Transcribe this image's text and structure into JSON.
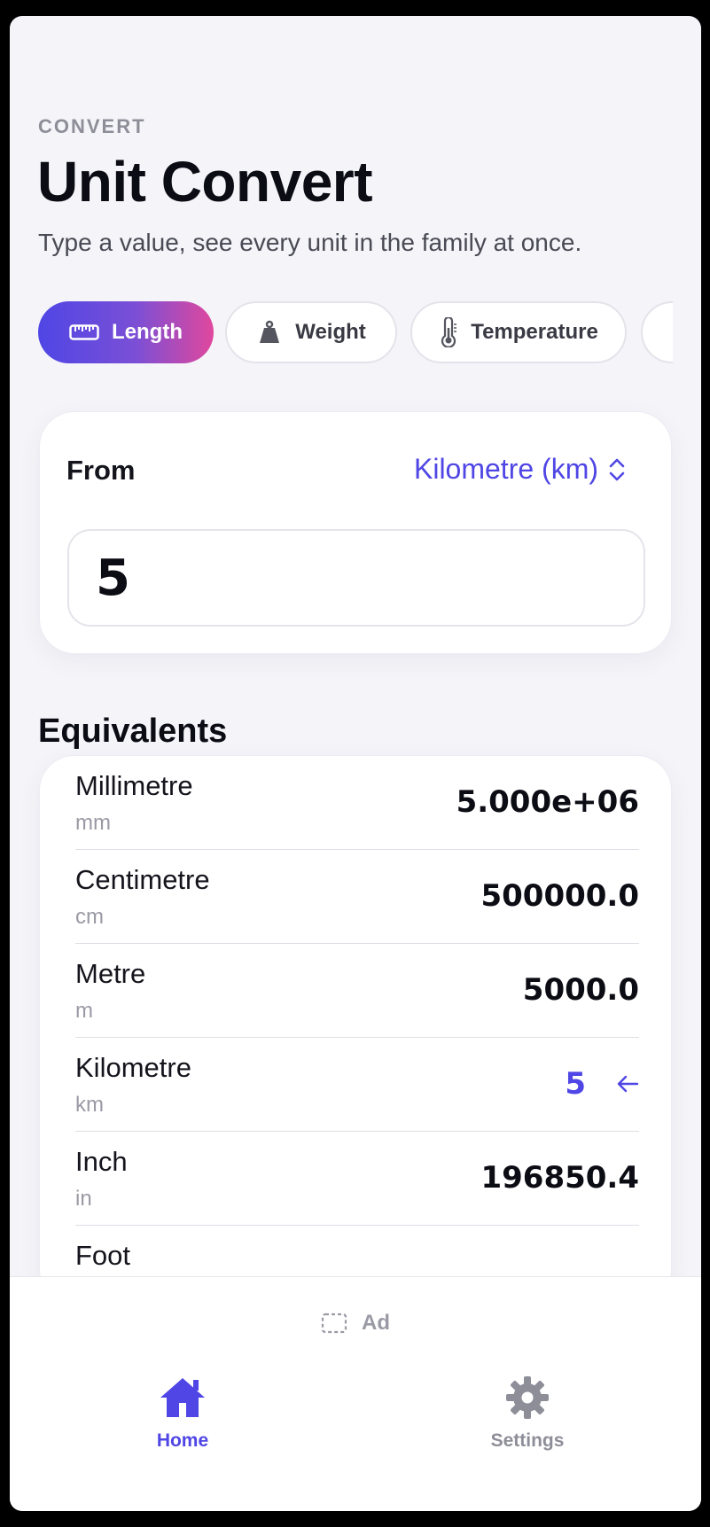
{
  "header": {
    "eyebrow": "CONVERT",
    "title": "Unit Convert",
    "subtitle": "Type a value, see every unit in the family at once."
  },
  "categories": [
    {
      "label": "Length",
      "icon": "ruler-icon",
      "active": true
    },
    {
      "label": "Weight",
      "icon": "weight-icon",
      "active": false
    },
    {
      "label": "Temperature",
      "icon": "thermometer-icon",
      "active": false
    }
  ],
  "from": {
    "label": "From",
    "unit": "Kilometre (km)",
    "value": "5"
  },
  "equivalents": {
    "title": "Equivalents",
    "rows": [
      {
        "name": "Millimetre",
        "abbr": "mm",
        "value": "5.000e+06"
      },
      {
        "name": "Centimetre",
        "abbr": "cm",
        "value": "500000.0"
      },
      {
        "name": "Metre",
        "abbr": "m",
        "value": "5000.0"
      },
      {
        "name": "Kilometre",
        "abbr": "km",
        "value": "5"
      },
      {
        "name": "Inch",
        "abbr": "in",
        "value": "196850.4"
      },
      {
        "name": "Foot",
        "abbr": "",
        "value": ""
      }
    ]
  },
  "ad": {
    "label": "Ad"
  },
  "tabs": [
    {
      "label": "Home",
      "icon": "home-icon",
      "active": true
    },
    {
      "label": "Settings",
      "icon": "gear-icon",
      "active": false
    }
  ],
  "colors": {
    "accent": "#4f46e5",
    "gradient_end": "#e0489d",
    "background": "#f4f4f9"
  }
}
